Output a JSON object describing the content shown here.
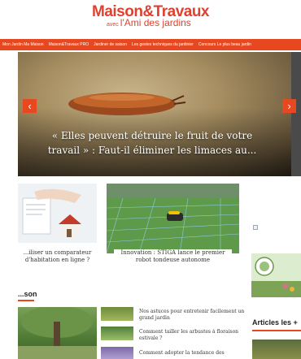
{
  "header": {
    "logo_main": "Maison&Travaux",
    "logo_sub_prefix": "avec",
    "logo_sub": "l'Ami des jardins"
  },
  "nav": {
    "items": [
      "Mon Jardin Ma Maison",
      "Maison&Travaux PRO",
      "Jardiner de saison",
      "Les gestes techniques du jardinier",
      "Concours Le plus beau jardin"
    ]
  },
  "hero": {
    "caption": "« Elles peuvent détruire le fruit de votre travail » : Faut-il éliminer les limaces au...",
    "prev_label": "‹",
    "next_label": "›"
  },
  "cards": [
    {
      "caption": "...iliser un comparateur d'habitation en ligne ?"
    },
    {
      "caption": "Innovation : STIGA lance le premier robot tondeuse autonome"
    }
  ],
  "section": {
    "title": "...son"
  },
  "list_items": [
    {
      "title": "Nos astuces pour entretenir facilement un grand jardin"
    },
    {
      "title": "Comment tailler les arbustes à floraison estivale ?"
    },
    {
      "title": "Comment adopter la tendance des"
    }
  ],
  "sidebar": {
    "title": "Articles les +"
  },
  "colors": {
    "accent": "#e8481f",
    "logo": "#e0412e"
  }
}
